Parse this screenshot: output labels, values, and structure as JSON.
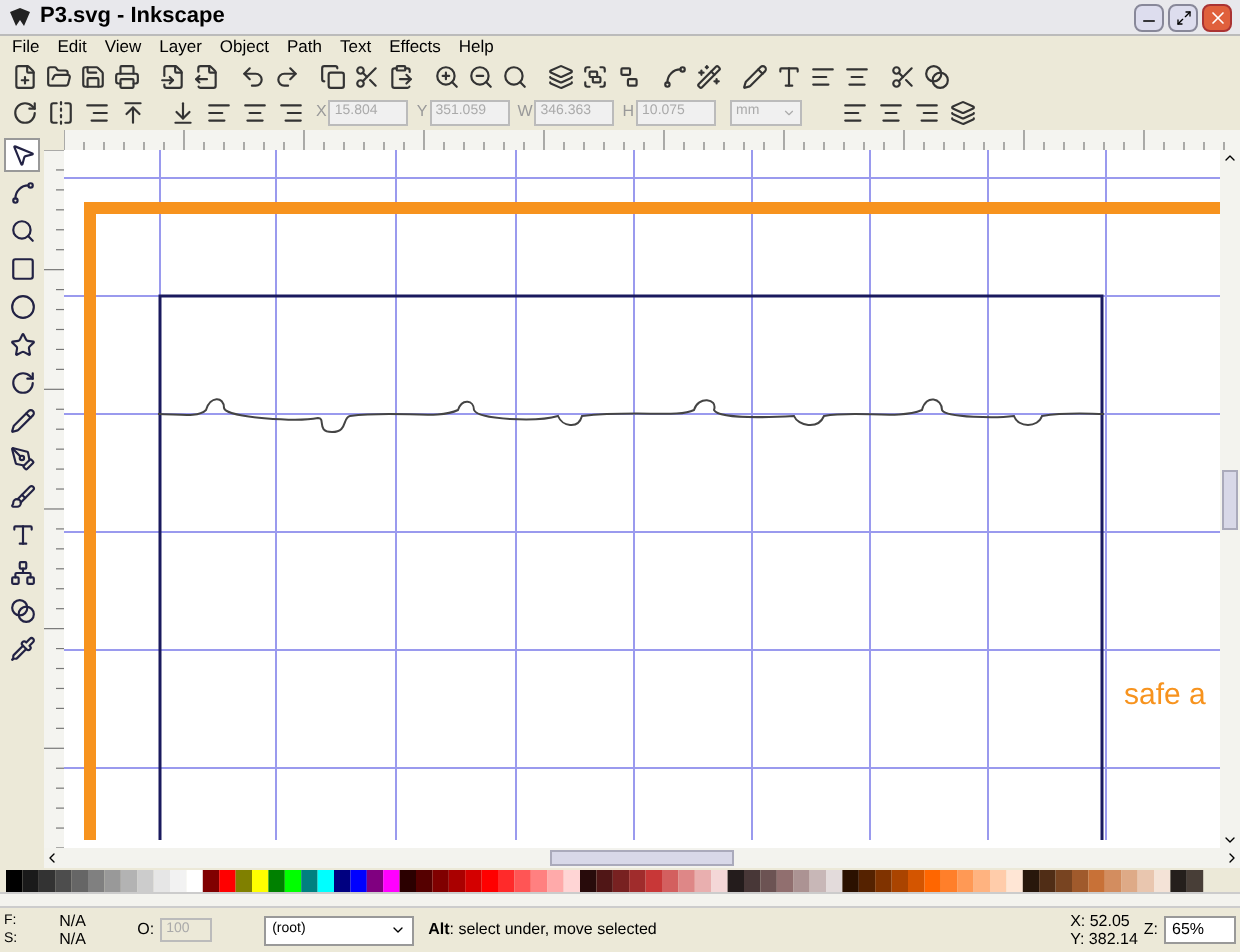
{
  "window": {
    "title": "P3.svg - Inkscape"
  },
  "menu": [
    "File",
    "Edit",
    "View",
    "Layer",
    "Object",
    "Path",
    "Text",
    "Effects",
    "Help"
  ],
  "tool_controls": [
    {
      "label": "X",
      "value": "15.804"
    },
    {
      "label": "Y",
      "value": "351.059"
    },
    {
      "label": "W",
      "value": "346.363"
    },
    {
      "label": "H",
      "value": "10.075"
    }
  ],
  "unit": {
    "value": "mm",
    "disabled": true
  },
  "tools": [
    {
      "kind": "select",
      "selected": true
    },
    {
      "kind": "node",
      "selected": false
    },
    {
      "kind": "zoom",
      "selected": false
    },
    {
      "kind": "rect",
      "selected": false
    },
    {
      "kind": "ellipse",
      "selected": false
    },
    {
      "kind": "star",
      "selected": false
    },
    {
      "kind": "spiral",
      "selected": false
    },
    {
      "kind": "pencil",
      "selected": false
    },
    {
      "kind": "pen",
      "selected": false
    },
    {
      "kind": "calligraphy",
      "selected": false
    },
    {
      "kind": "text",
      "selected": false
    },
    {
      "kind": "connector",
      "selected": false
    },
    {
      "kind": "gradient",
      "selected": false
    },
    {
      "kind": "dropper",
      "selected": false
    }
  ],
  "canvas": {
    "text": "safe a"
  },
  "status_bar": {
    "fill_label": "F:",
    "stroke_label": "S:",
    "fill": "N/A",
    "stroke": "N/A",
    "opacity_label": "O:",
    "opacity": "100",
    "layer": "(root)",
    "message": "**Alt**: select under, move selected",
    "x": "X: 52.05",
    "y": "Y: 382.14",
    "zoom_label": "Z:",
    "zoom": "65%"
  }
}
